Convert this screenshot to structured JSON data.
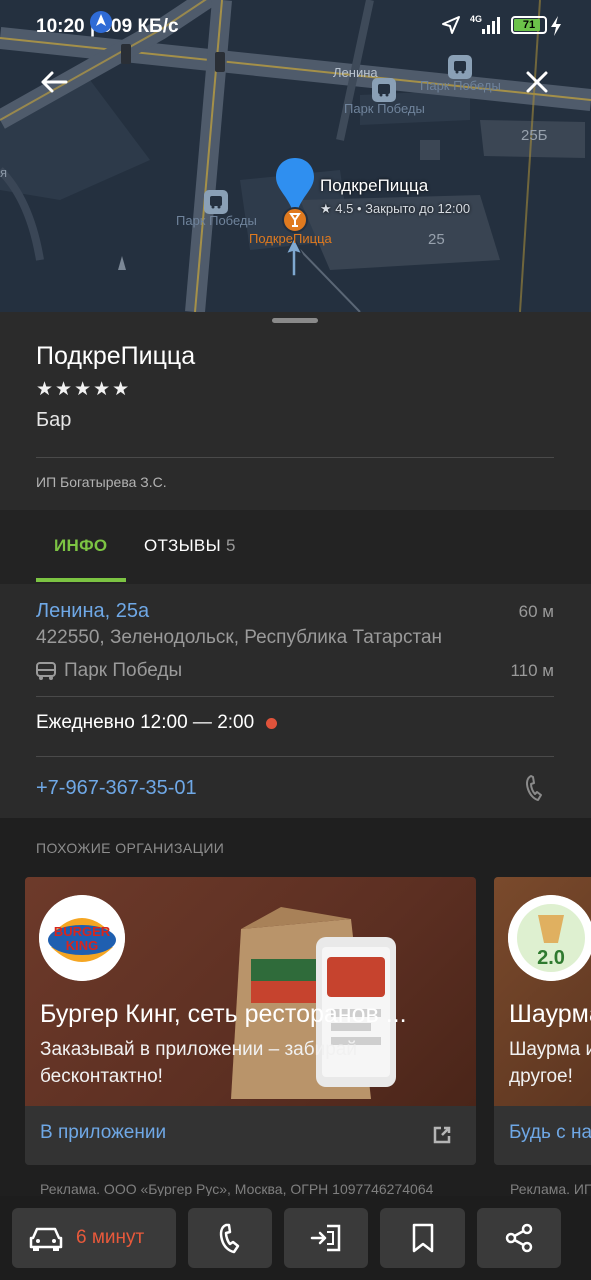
{
  "status_bar": {
    "time_speed": "10:20 | 509 КБ/с",
    "network": "4G",
    "battery": "71"
  },
  "map": {
    "street_label": "Ленина",
    "stop_labels": [
      "Парк Победы",
      "Парк Победы",
      "Парк Победы"
    ],
    "building_numbers": [
      "25Б",
      "25"
    ],
    "poi_name": "ПодкреПицца",
    "poi_meta": "★ 4.5 • Закрыто до 12:00",
    "poi_under_label": "ПодкреПицца",
    "edge_label": "я"
  },
  "place": {
    "title": "ПодкреПицца",
    "stars": "★★★★★",
    "category": "Бар",
    "owner": "ИП Богатырева З.С."
  },
  "tabs": {
    "info": "ИНФО",
    "reviews": "ОТЗЫВЫ",
    "reviews_count": "5"
  },
  "info": {
    "address": "Ленина, 25а",
    "address_distance": "60 м",
    "address_full": "422550, Зеленодольск, Республика Татарстан",
    "stop_name": "Парк Победы",
    "stop_distance": "110 м",
    "hours": "Ежедневно 12:00 — 2:00",
    "phone": "+7-967-367-35-01"
  },
  "similar": {
    "title": "ПОХОЖИЕ ОРГАНИЗАЦИИ",
    "cards": [
      {
        "logo_text_1": "BURGER",
        "logo_text_2": "KING",
        "headline": "Бургер Кинг, сеть ресторанов ...",
        "subtitle": "Заказывай в приложении – забирай бесконтактно!",
        "action": "В приложении",
        "ad_note": "Реклама. ООО «Бургер Рус», Москва, ОГРН 1097746274064"
      },
      {
        "logo_text": "2.0",
        "headline": "Шаурма",
        "subtitle": "Шаурма и другое!",
        "action": "Будь с нами",
        "ad_note": "Реклама. ИП"
      }
    ]
  },
  "bottom_bar": {
    "route_time": "6 минут"
  },
  "colors": {
    "accent_green": "#7cc443",
    "link_blue": "#6fa8e6",
    "closed_red": "#e0533b",
    "route_orange": "#e8593b",
    "poi_pin_blue": "#2f8ff0"
  }
}
